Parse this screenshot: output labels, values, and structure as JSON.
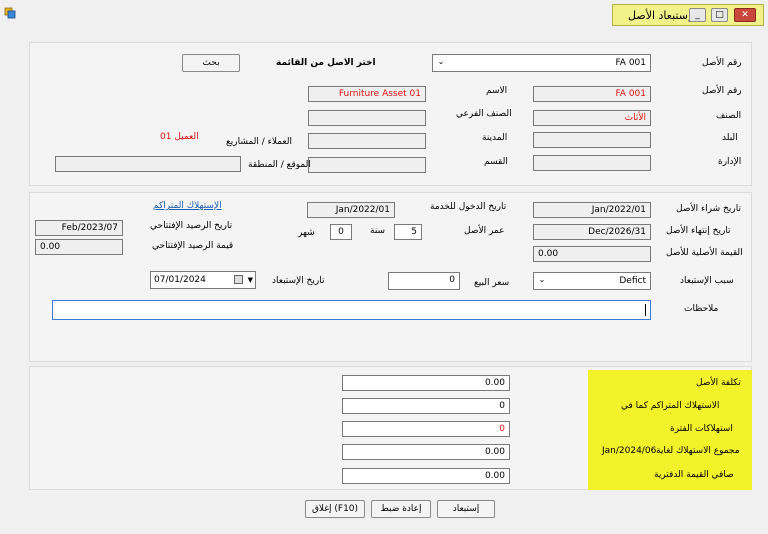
{
  "window": {
    "title": "إستبعاد الأصل",
    "minimize": "_",
    "maximize": "□",
    "close": "✕"
  },
  "top": {
    "asset_no_label": "رقم الأصل",
    "asset_no_combo": "FA 001",
    "choose_label": "اختر الاصل من القائمة",
    "search_btn": "بحث",
    "asset_no2_label": "رقم الأصل",
    "asset_no2": "FA 001",
    "name_label": "الاسم",
    "name_value": "Furniture Asset 01",
    "category_label": "الصنف",
    "category_value": "الأثاث",
    "subcategory_label": "الصنف الفرعي",
    "country_label": "البلد",
    "city_label": "المدينة",
    "customers_label": "العملاء / المشاريع",
    "customer_value": "العميل 01",
    "department_label": "الإدارة",
    "section_label": "القسم",
    "location_label": "الموقع / المنطقة"
  },
  "middle": {
    "purchase_date_label": "تاريخ شراء الأصل",
    "purchase_date": "Jan/2022/01",
    "service_date_label": "تاريخ الدخول للخدمة",
    "service_date": "Jan/2022/01",
    "accum_link": "الإستهلاك المتراكم",
    "end_date_label": "تاريخ إنتهاء الأصل",
    "end_date": "Dec/2026/31",
    "age_label": "عمر الأصل",
    "years_value": "5",
    "years_label": "سنة",
    "months_value": "0",
    "months_label": "شهر",
    "opening_date_label": "تاريخ الرصيد الإفتتاحي",
    "opening_date": "Feb/2023/07",
    "original_value_label": "القيمة الأصلية للأصل",
    "original_value": "0.00",
    "opening_value_label": "قيمة الرصيد الإفتتاحي",
    "opening_value": "0.00",
    "reason_label": "سبب الإستبعاد",
    "reason_value": "Defict",
    "sale_price_label": "سعر البيع",
    "sale_price": "0",
    "disposal_date_label": "تاريخ الإستبعاد",
    "disposal_date": "07/01/2024",
    "notes_label": "ملاحظات",
    "notes_value": ""
  },
  "bottom": {
    "rows": [
      {
        "label": "تكلفة الأصل",
        "value": "0.00"
      },
      {
        "label": "الاستهلاك المتراكم كما في",
        "value": "0"
      },
      {
        "label": "استهلاكات الفترة",
        "value": "0"
      },
      {
        "label": "مجموع الاستهلاك لغاية",
        "date": "Jan/2024/06",
        "value": "0.00"
      },
      {
        "label": "صافي القيمة الدفترية",
        "value": "0.00"
      }
    ]
  },
  "footer": {
    "close_btn": "إغلاق (F10)",
    "reset_btn": "إعادة ضبط",
    "dispose_btn": "إستبعاد"
  },
  "colors": {
    "title_bg": "#f2f28a",
    "yellow_panel": "#f2f22a",
    "red_text": "#dd1111",
    "link": "#1a5fb4"
  }
}
